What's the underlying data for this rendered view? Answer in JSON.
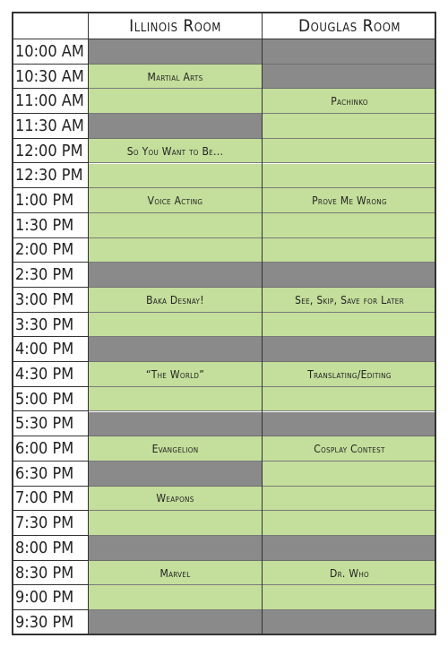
{
  "headers": {
    "col1": "Illinois Room",
    "col2": "Douglas Room"
  },
  "times": [
    "10:00 AM",
    "10:30 AM",
    "11:00 AM",
    "11:30 AM",
    "12:00 PM",
    "12:30 PM",
    "1:00 PM",
    "1:30 PM",
    "2:00 PM",
    "2:30 PM",
    "3:00 PM",
    "3:30 PM",
    "4:00 PM",
    "4:30 PM",
    "5:00 PM",
    "5:30 PM",
    "6:00 PM",
    "6:30 PM",
    "7:00 PM",
    "7:30 PM",
    "8:00 PM",
    "8:30 PM",
    "9:00 PM",
    "9:30 PM"
  ],
  "colors": {
    "event": "#c4de9b",
    "break": "#8a8a8a"
  },
  "illinois_events": [
    {
      "name": "Martial Arts",
      "start": 1,
      "slots": 2
    },
    {
      "name": "So You Want to Be...",
      "start": 4,
      "slots": 2
    },
    {
      "name": "Voice Acting",
      "start": 6,
      "slots": 3
    },
    {
      "name": "Baka Desnay!",
      "start": 10,
      "slots": 2
    },
    {
      "name": "“The World”",
      "start": 13,
      "slots": 2
    },
    {
      "name": "Evangelion",
      "start": 16,
      "slots": 1
    },
    {
      "name": "Weapons",
      "start": 18,
      "slots": 2
    },
    {
      "name": "Marvel",
      "start": 21,
      "slots": 2
    }
  ],
  "douglas_events": [
    {
      "name": "Pachinko",
      "start": 2,
      "slots": 4
    },
    {
      "name": "Prove Me Wrong",
      "start": 6,
      "slots": 3
    },
    {
      "name": "See, Skip, Save for Later",
      "start": 10,
      "slots": 2
    },
    {
      "name": "Translating/Editing",
      "start": 13,
      "slots": 2
    },
    {
      "name": "Cosplay Contest",
      "start": 16,
      "slots": 4
    },
    {
      "name": "Dr. Who",
      "start": 21,
      "slots": 2
    }
  ]
}
